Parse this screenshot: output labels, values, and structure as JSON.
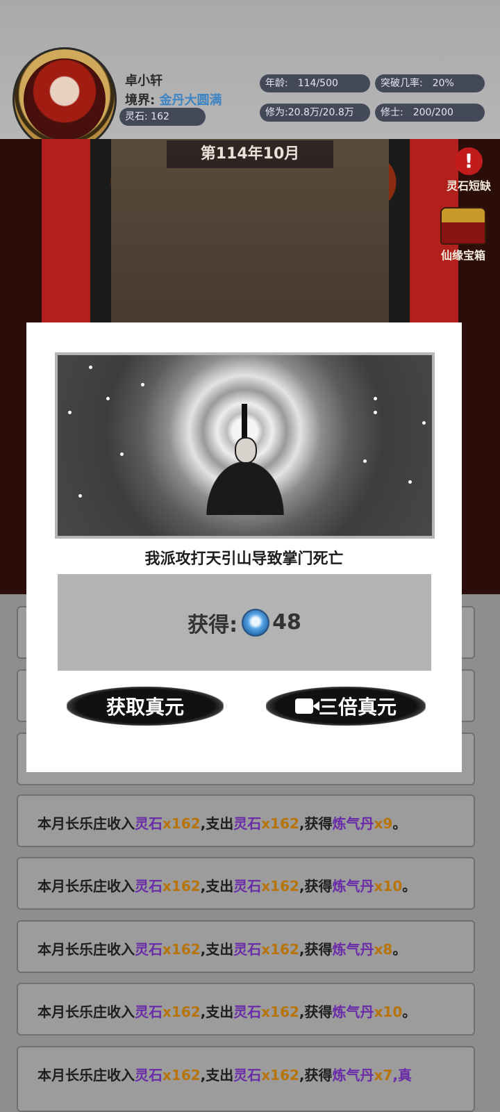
{
  "player": {
    "name": "卓小轩",
    "realm_label": "境界:",
    "realm_value": "金丹大圆满",
    "spirit_stone": "灵石:   162"
  },
  "stats": {
    "age_label": "年龄:",
    "age_value": "114/500",
    "breakthrough_label": "突破几率:",
    "breakthrough_value": "20%",
    "cultivation": "修为:20.8万/20.8万",
    "cultivators_label": "修士:",
    "cultivators_value": "200/200"
  },
  "date": "第114年10月",
  "side_buttons": {
    "shortage_label": "灵石短缺",
    "chest_label": "仙缘宝箱"
  },
  "modal": {
    "event_text": "我派攻打天引山导致掌门死亡",
    "reward_label": "获得:",
    "reward_amount": "48",
    "claim_label": "获取真元",
    "triple_label": "三倍真元"
  },
  "logs": [
    {
      "prefix": "本月长乐庄收入",
      "a": "灵石",
      "b": "x162",
      "c": ",支出",
      "d": "灵石",
      "e": "x162",
      "f": ",获得",
      "g": "炼气丹",
      "h": "x9",
      "i": "。"
    },
    {
      "prefix": "本月长乐庄收入",
      "a": "灵石",
      "b": "x162",
      "c": ",支出",
      "d": "灵石",
      "e": "x162",
      "f": ",获得",
      "g": "炼气丹",
      "h": "x10",
      "i": "。"
    },
    {
      "prefix": "本月长乐庄收入",
      "a": "灵石",
      "b": "x162",
      "c": ",支出",
      "d": "灵石",
      "e": "x162",
      "f": ",获得",
      "g": "炼气丹",
      "h": "x8",
      "i": "。"
    },
    {
      "prefix": "本月长乐庄收入",
      "a": "灵石",
      "b": "x162",
      "c": ",支出",
      "d": "灵石",
      "e": "x162",
      "f": ",获得",
      "g": "炼气丹",
      "h": "x10",
      "i": "。"
    },
    {
      "prefix": "本月长乐庄收入",
      "a": "灵石",
      "b": "x162",
      "c": ",支出",
      "d": "灵石",
      "e": "x162",
      "f": ",获得",
      "g": "炼气丹",
      "h": "x7",
      "i": ",真"
    }
  ]
}
